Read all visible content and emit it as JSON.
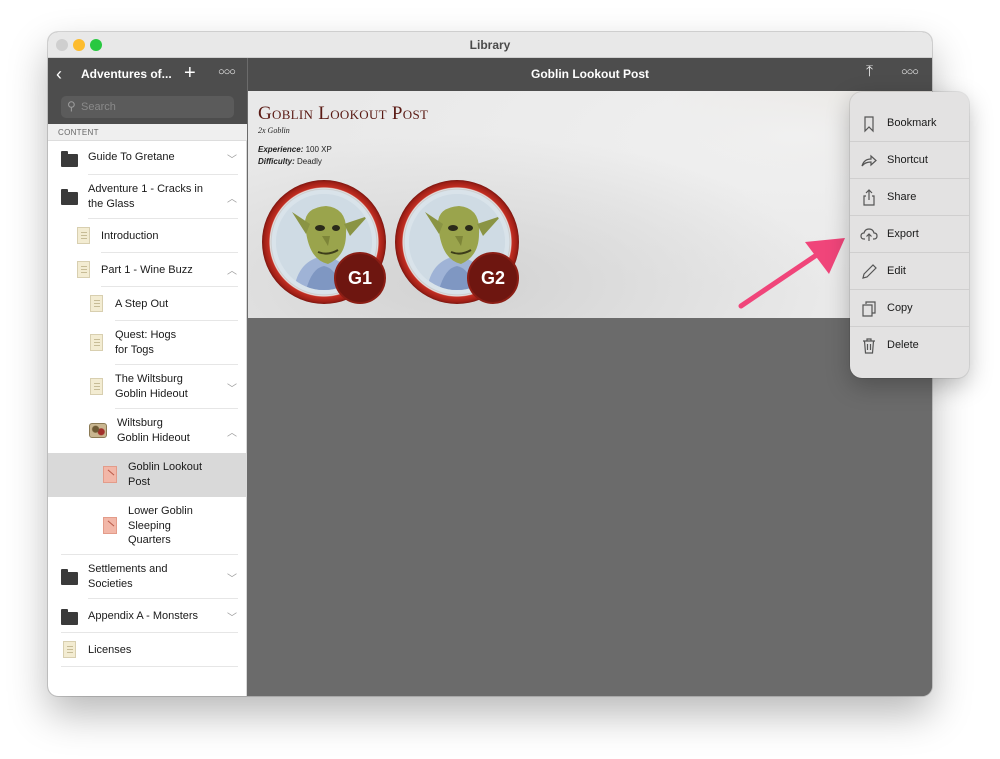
{
  "window": {
    "title": "Library"
  },
  "sidebar": {
    "title": "Adventures of...",
    "search_placeholder": "Search",
    "section_label": "CONTENT",
    "items": [
      {
        "label": "Guide To Gretane",
        "icon": "folder-icon",
        "chevron": "down"
      },
      {
        "label": "Adventure 1 - Cracks in the Glass",
        "icon": "folder-icon",
        "chevron": "up"
      },
      {
        "label": "Introduction",
        "icon": "document-icon"
      },
      {
        "label": "Part 1 - Wine Buzz",
        "icon": "document-icon",
        "chevron": "up"
      },
      {
        "label": "A Step Out",
        "icon": "document-icon"
      },
      {
        "label": "Quest: Hogs for Togs",
        "icon": "document-icon"
      },
      {
        "label": "The Wiltsburg Goblin Hideout",
        "icon": "document-icon",
        "chevron": "down"
      },
      {
        "label": "Wiltsburg Goblin Hideout",
        "icon": "map-icon",
        "chevron": "up"
      },
      {
        "label": "Goblin Lookout Post",
        "icon": "encounter-icon",
        "selected": true
      },
      {
        "label": "Lower Goblin Sleeping Quarters",
        "icon": "encounter-icon"
      },
      {
        "label": "Settlements and Societies",
        "icon": "folder-icon",
        "chevron": "down"
      },
      {
        "label": "Appendix A - Monsters",
        "icon": "folder-icon",
        "chevron": "down"
      },
      {
        "label": "Licenses",
        "icon": "document-icon"
      }
    ]
  },
  "navbar": {
    "title": "Goblin Lookout Post"
  },
  "encounter": {
    "title": "Goblin Lookout Post",
    "subtitle": "2x Goblin",
    "experience_label": "Experience:",
    "experience_value": "100 XP",
    "difficulty_label": "Difficulty:",
    "difficulty_value": "Deadly",
    "tokens": [
      {
        "label": "G1"
      },
      {
        "label": "G2"
      }
    ]
  },
  "menu": {
    "items": [
      {
        "label": "Bookmark",
        "icon": "bookmark-icon"
      },
      {
        "label": "Shortcut",
        "icon": "shortcut-icon"
      },
      {
        "label": "Share",
        "icon": "share-icon"
      },
      {
        "label": "Export",
        "icon": "cloud-upload-icon"
      },
      {
        "label": "Edit",
        "icon": "pencil-icon"
      },
      {
        "label": "Copy",
        "icon": "copy-icon"
      },
      {
        "label": "Delete",
        "icon": "trash-icon"
      }
    ]
  },
  "colors": {
    "accent_arrow": "#f0457a",
    "title_red": "#5a1a14",
    "token_red": "#6e1610",
    "toolbar": "#4d4d4d"
  }
}
